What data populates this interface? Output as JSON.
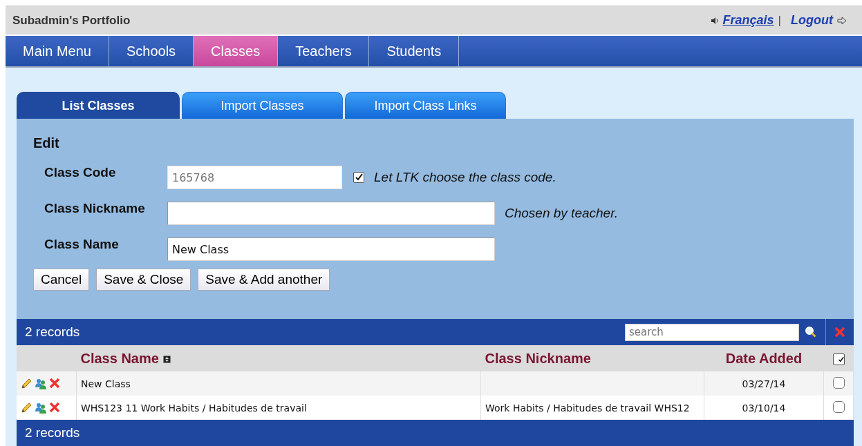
{
  "header": {
    "title": "Subadmin's Portfolio",
    "language_link": "Français",
    "separator": "|",
    "logout_link": "Logout"
  },
  "nav": [
    {
      "label": "Main Menu",
      "selected": false
    },
    {
      "label": "Schools",
      "selected": false
    },
    {
      "label": "Classes",
      "selected": true
    },
    {
      "label": "Teachers",
      "selected": false
    },
    {
      "label": "Students",
      "selected": false
    }
  ],
  "tabs": [
    {
      "label": "List Classes",
      "selected": true
    },
    {
      "label": "Import Classes",
      "selected": false
    },
    {
      "label": "Import Class Links",
      "selected": false
    }
  ],
  "form": {
    "heading": "Edit",
    "fields": [
      {
        "label": "Class Code",
        "value": "165768",
        "disabled": true,
        "checkbox": {
          "label": "Let LTK choose the class code.",
          "checked": true
        }
      },
      {
        "label": "Class Nickname",
        "disabled": false,
        "note": "Chosen by teacher."
      },
      {
        "label": "Class Name",
        "value": "New Class",
        "disabled": false
      }
    ],
    "buttons": [
      "Cancel",
      "Save & Close",
      "Save & Add another"
    ]
  },
  "table": {
    "record_count": "2 records",
    "search": {
      "placeholder": "search"
    },
    "columns": [
      "Class Name",
      "Class Nickname",
      "Date Added"
    ],
    "select_all": {
      "checked": true
    },
    "rows": [
      {
        "name": "New Class",
        "date": "03/27/14",
        "checked": false
      },
      {
        "name": "WHS123 11 Work Habits / Habitudes de travail",
        "nickname": "Work Habits / Habitudes de travail WHS12",
        "date": "03/10/14",
        "checked": false
      }
    ],
    "footer": "2 records"
  }
}
